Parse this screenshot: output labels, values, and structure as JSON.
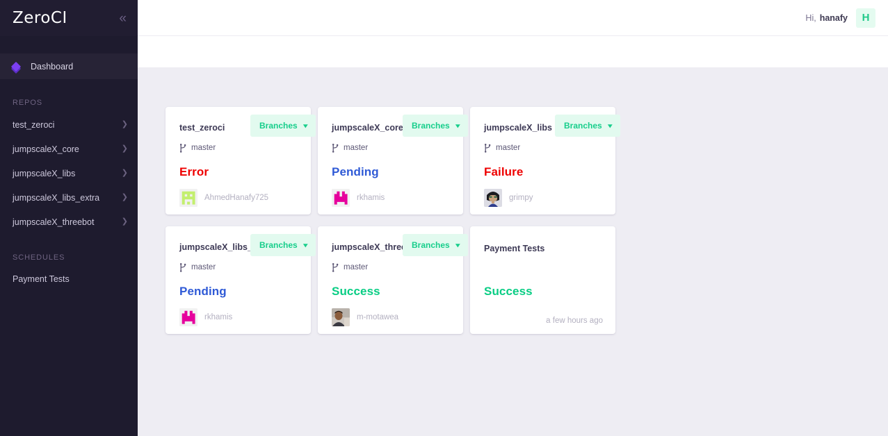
{
  "brand": {
    "name": "ZeroCI",
    "collapse_icon": "chevrons-left-icon"
  },
  "sidebar": {
    "dashboard": {
      "label": "Dashboard",
      "icon": "diamond-icon"
    },
    "repos_label": "REPOS",
    "repos": [
      {
        "label": "test_zeroci"
      },
      {
        "label": "jumpscaleX_core"
      },
      {
        "label": "jumpscaleX_libs"
      },
      {
        "label": "jumpscaleX_libs_extra"
      },
      {
        "label": "jumpscaleX_threebot"
      }
    ],
    "schedules_label": "SCHEDULES",
    "schedules": [
      {
        "label": "Payment Tests"
      }
    ]
  },
  "topbar": {
    "greeting": "Hi,",
    "username": "hanafy",
    "avatar_letter": "H"
  },
  "colors": {
    "sidebar_bg": "#1e1b2e",
    "content_bg": "#eeedf3",
    "accent_green": "#17ce8b",
    "branches_bg": "#e2faef",
    "error_red": "#ee0000",
    "pending_blue": "#2f5ad6",
    "success_green": "#09cd84",
    "brand_purple": "#7b3ff2"
  },
  "cards": [
    {
      "type": "repo",
      "repo": "test_zeroci",
      "branches_label": "Branches",
      "branch": "master",
      "status": "Error",
      "status_class": "error",
      "author": "AhmedHanafy725",
      "avatar_kind": "identicon-green"
    },
    {
      "type": "repo",
      "repo": "jumpscaleX_core",
      "branches_label": "Branches",
      "branch": "master",
      "status": "Pending",
      "status_class": "pending",
      "author": "rkhamis",
      "avatar_kind": "identicon-magenta"
    },
    {
      "type": "repo",
      "repo": "jumpscaleX_libs",
      "branches_label": "Branches",
      "branch": "master",
      "status": "Failure",
      "status_class": "failure",
      "author": "grimpy",
      "avatar_kind": "photo-grimpy"
    },
    {
      "type": "repo",
      "repo": "jumpscaleX_libs_extra",
      "branches_label": "Branches",
      "branch": "master",
      "status": "Pending",
      "status_class": "pending",
      "author": "rkhamis",
      "avatar_kind": "identicon-magenta"
    },
    {
      "type": "repo",
      "repo": "jumpscaleX_threebot",
      "branches_label": "Branches",
      "branch": "master",
      "status": "Success",
      "status_class": "success",
      "author": "m-motawea",
      "avatar_kind": "photo-motawea"
    },
    {
      "type": "schedule",
      "repo": "Payment Tests",
      "status": "Success",
      "status_class": "success",
      "timeago": "a few hours ago"
    }
  ]
}
